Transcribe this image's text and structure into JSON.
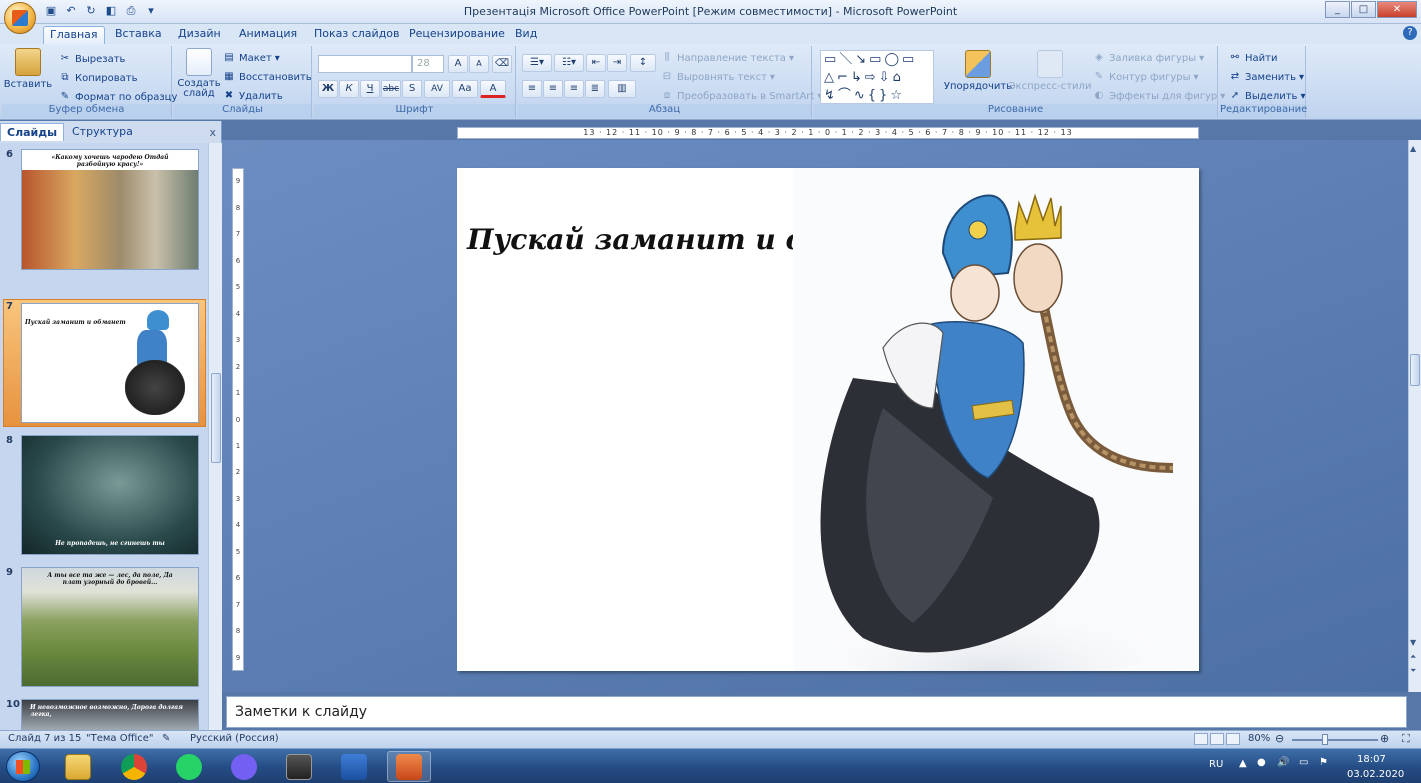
{
  "window": {
    "title": "Презентація Microsoft Office PowerPoint [Режим совместимости] - Microsoft PowerPoint",
    "minimize": "_",
    "maximize": "□",
    "close": "✕"
  },
  "tabs": [
    "Главная",
    "Вставка",
    "Дизайн",
    "Анимация",
    "Показ слайдов",
    "Рецензирование",
    "Вид"
  ],
  "ribbon": {
    "clipboard": {
      "label": "Буфер обмена",
      "paste": "Вставить",
      "cut": "Вырезать",
      "copy": "Копировать",
      "format": "Формат по образцу"
    },
    "slides": {
      "label": "Слайды",
      "new_slide": "Создать слайд",
      "layout": "Макет",
      "reset": "Восстановить",
      "delete": "Удалить"
    },
    "font": {
      "label": "Шрифт",
      "size_value": "28",
      "bold": "Ж",
      "italic": "К",
      "underline": "Ч",
      "strike": "abc",
      "shadow": "S",
      "spacing": "AV",
      "case": "Aa",
      "color": "A",
      "grow": "A",
      "shrink": "A"
    },
    "paragraph": {
      "label": "Абзац",
      "direction": "Направление текста",
      "align_text": "Выровнять текст",
      "smartart": "Преобразовать в SmartArt"
    },
    "drawing": {
      "label": "Рисование",
      "arrange": "Упорядочить",
      "quick_styles": "Экспресс-стили",
      "fill": "Заливка фигуры",
      "outline": "Контур фигуры",
      "effects": "Эффекты для фигур"
    },
    "editing": {
      "label": "Редактирование",
      "find": "Найти",
      "replace": "Заменить",
      "select": "Выделить"
    }
  },
  "panel": {
    "tab_slides": "Слайды",
    "tab_outline": "Структура",
    "close": "x",
    "slides": [
      {
        "num": "6",
        "caption": "«Какому хочешь чародею Отдай разбойную красу!»"
      },
      {
        "num": "7",
        "caption": "Пускай заманит и обманет"
      },
      {
        "num": "8",
        "caption": "Не пропадешь, не сгинешь ты"
      },
      {
        "num": "9",
        "caption": "А ты все та же — лес, да поле, Да плат узорный до бровей..."
      },
      {
        "num": "10",
        "caption": "И невозможное возможно, Дорога долгая легка,"
      }
    ]
  },
  "ruler": {
    "top": "13 · 12 · 11 · 10 · 9 · 8 · 7 · 6 · 5 · 4 · 3 · 2 · 1 · 0 · 1 · 2 · 3 · 4 · 5 · 6 · 7 · 8 · 9 · 10 · 11 · 12 · 13",
    "left": [
      "9",
      "8",
      "7",
      "6",
      "5",
      "4",
      "3",
      "2",
      "1",
      "0",
      "1",
      "2",
      "3",
      "4",
      "5",
      "6",
      "7",
      "8",
      "9"
    ]
  },
  "slide": {
    "title": "Пускай заманит и обманет"
  },
  "notes": {
    "placeholder": "Заметки к слайду"
  },
  "status": {
    "slide_counter": "Слайд 7 из 15",
    "theme": "\"Тема Office\"",
    "language": "Русский (Россия)",
    "zoom": "80%"
  },
  "taskbar": {
    "apps": [
      "explorer",
      "chrome",
      "whatsapp",
      "viber",
      "video-editor",
      "word",
      "powerpoint"
    ],
    "lang": "RU",
    "time": "18:07",
    "date": "03.02.2020"
  }
}
